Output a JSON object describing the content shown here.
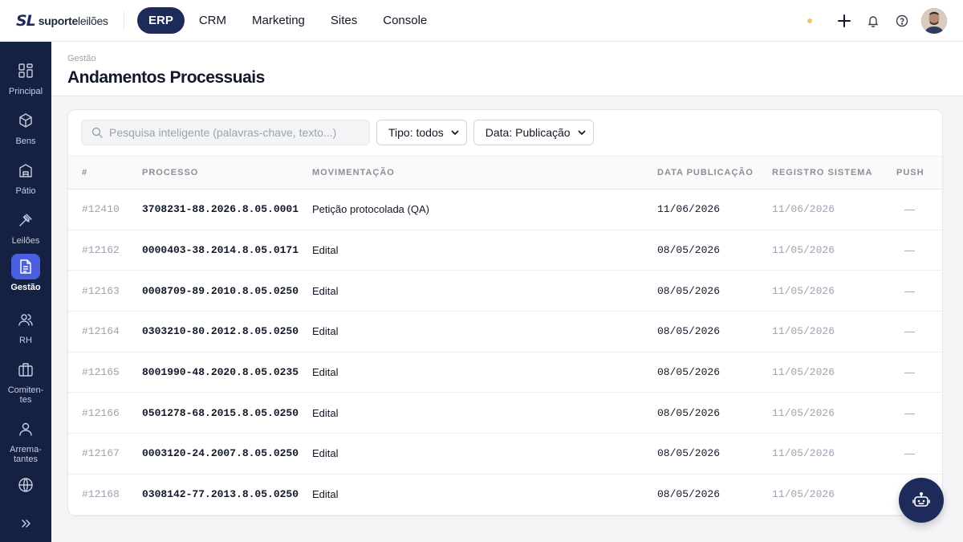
{
  "brand": {
    "mark": "SL",
    "name_bold": "suporte",
    "name_rest": "leilões"
  },
  "topnav": [
    {
      "label": "ERP",
      "active": true
    },
    {
      "label": "CRM"
    },
    {
      "label": "Marketing"
    },
    {
      "label": "Sites"
    },
    {
      "label": "Console"
    }
  ],
  "sidebar": [
    {
      "label": "Principal",
      "icon": "grid-icon"
    },
    {
      "label": "Bens",
      "icon": "box-icon"
    },
    {
      "label": "Pátio",
      "icon": "warehouse-icon"
    },
    {
      "label": "Leilões",
      "icon": "gavel-icon"
    },
    {
      "label": "Gestão",
      "icon": "document-icon",
      "active": true
    },
    {
      "label": "RH",
      "icon": "users-icon"
    },
    {
      "label": "Comiten-tes",
      "icon": "briefcase-icon"
    },
    {
      "label": "Arrema-tantes",
      "icon": "user-icon"
    },
    {
      "label": "",
      "icon": "globe-icon"
    }
  ],
  "header": {
    "breadcrumb": "Gestão",
    "title": "Andamentos Processuais"
  },
  "filters": {
    "search_placeholder": "Pesquisa inteligente (palavras-chave, texto...)",
    "tipo": "Tipo: todos",
    "data": "Data: Publicação"
  },
  "table": {
    "columns": [
      "#",
      "PROCESSO",
      "MOVIMENTAÇÃO",
      "DATA PUBLICAÇÃO",
      "REGISTRO SISTEMA",
      "PUSH"
    ],
    "rows": [
      {
        "id": "#12410",
        "processo": "3708231-88.2026.8.05.0001",
        "mov": "Petição protocolada (QA)",
        "pub": "11/06/2026",
        "reg": "11/06/2026",
        "push": "—"
      },
      {
        "id": "#12162",
        "processo": "0000403-38.2014.8.05.0171",
        "mov": "Edital",
        "pub": "08/05/2026",
        "reg": "11/05/2026",
        "push": "—"
      },
      {
        "id": "#12163",
        "processo": "0008709-89.2010.8.05.0250",
        "mov": "Edital",
        "pub": "08/05/2026",
        "reg": "11/05/2026",
        "push": "—"
      },
      {
        "id": "#12164",
        "processo": "0303210-80.2012.8.05.0250",
        "mov": "Edital",
        "pub": "08/05/2026",
        "reg": "11/05/2026",
        "push": "—"
      },
      {
        "id": "#12165",
        "processo": "8001990-48.2020.8.05.0235",
        "mov": "Edital",
        "pub": "08/05/2026",
        "reg": "11/05/2026",
        "push": "—"
      },
      {
        "id": "#12166",
        "processo": "0501278-68.2015.8.05.0250",
        "mov": "Edital",
        "pub": "08/05/2026",
        "reg": "11/05/2026",
        "push": "—"
      },
      {
        "id": "#12167",
        "processo": "0003120-24.2007.8.05.0250",
        "mov": "Edital",
        "pub": "08/05/2026",
        "reg": "11/05/2026",
        "push": "—"
      },
      {
        "id": "#12168",
        "processo": "0308142-77.2013.8.05.0250",
        "mov": "Edital",
        "pub": "08/05/2026",
        "reg": "11/05/2026",
        "push": ""
      }
    ]
  },
  "colors": {
    "navy": "#1e2a5a",
    "sidebar": "#152143",
    "active": "#4a5fe0",
    "notify_dot": "#f5c26b"
  }
}
